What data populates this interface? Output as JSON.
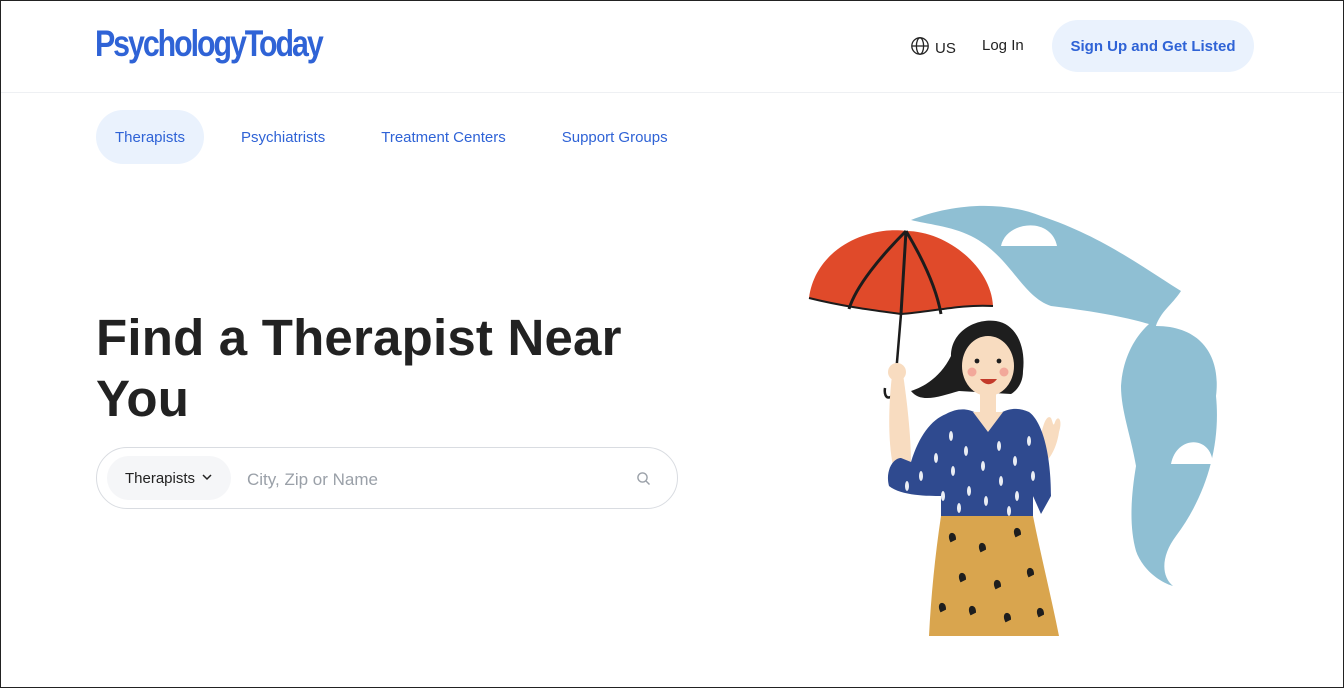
{
  "header": {
    "logo_text": "PsychologyToday",
    "region_label": "US",
    "login_label": "Log In",
    "signup_label": "Sign Up and Get Listed"
  },
  "tabs": [
    {
      "label": "Therapists",
      "active": true
    },
    {
      "label": "Psychiatrists",
      "active": false
    },
    {
      "label": "Treatment Centers",
      "active": false
    },
    {
      "label": "Support Groups",
      "active": false
    }
  ],
  "hero": {
    "title": "Find a Therapist Near You"
  },
  "search": {
    "type_selected": "Therapists",
    "placeholder": "City, Zip or Name",
    "value": ""
  },
  "icons": {
    "region": "globe-icon",
    "dropdown": "chevron-down-icon",
    "search": "search-icon"
  },
  "colors": {
    "brand": "#2f63d6",
    "pill_bg": "#eaf2fd",
    "heading": "#222222",
    "umbrella": "#e04a2a",
    "blouse": "#2f4a8f",
    "skirt": "#d9a54e",
    "sky_shape": "#8fbfd3"
  }
}
